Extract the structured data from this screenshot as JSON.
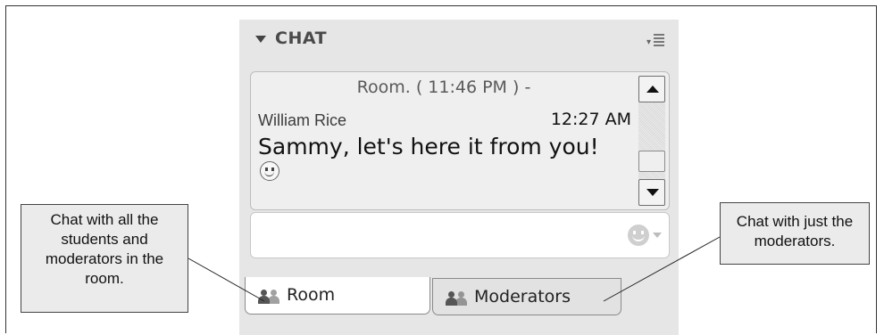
{
  "chat_pod": {
    "title": "CHAT",
    "messages": {
      "system_message": "Room. ( 11:46 PM ) -",
      "author": "William Rice",
      "time": "12:27 AM",
      "text": "Sammy, let's here it from you!"
    },
    "input": {
      "placeholder": ""
    },
    "tabs": [
      {
        "label": "Room",
        "active": true
      },
      {
        "label": "Moderators",
        "active": false
      }
    ]
  },
  "callouts": {
    "left": "Chat with all the\nstudents and\nmoderators in the\nroom.",
    "right": "Chat with just the\nmoderators."
  },
  "colors": {
    "panel_bg": "#e6e6e6",
    "callout_bg": "#ebebeb",
    "active_tab_bg": "#ffffff"
  },
  "icons": [
    "collapse-triangle-icon",
    "pod-menu-icon",
    "scroll-up-icon",
    "scroll-down-icon",
    "smiley-icon",
    "emoticon-picker-icon",
    "users-icon"
  ]
}
